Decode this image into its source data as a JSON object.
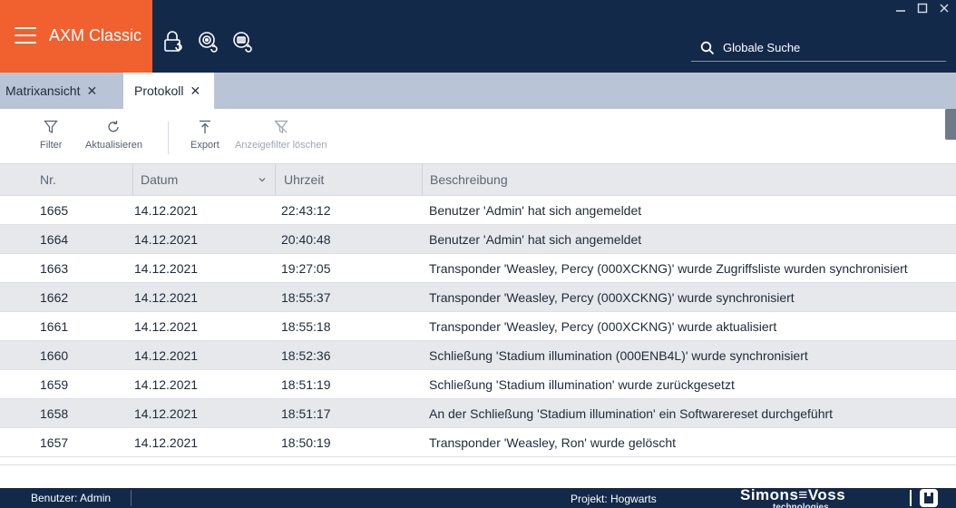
{
  "app": {
    "title": "AXM Classic",
    "window_controls": [
      "minimize",
      "maximize",
      "close"
    ]
  },
  "header": {
    "tools": [
      {
        "icon": "lock-sync-icon"
      },
      {
        "icon": "transponder-sync-icon"
      },
      {
        "icon": "card-sync-icon"
      }
    ],
    "search_placeholder": "Globale Suche"
  },
  "tabs": [
    {
      "label": "Matrixansicht",
      "active": false
    },
    {
      "label": "Protokoll",
      "active": true
    }
  ],
  "toolbar": {
    "filter": "Filter",
    "refresh": "Aktualisieren",
    "export": "Export",
    "clear_filter": "Anzeigefilter löschen"
  },
  "table": {
    "columns": [
      "Nr.",
      "Datum",
      "Uhrzeit",
      "Beschreibung"
    ],
    "rows": [
      {
        "nr": "1665",
        "datum": "14.12.2021",
        "uhrzeit": "22:43:12",
        "beschreibung": "Benutzer 'Admin' hat sich angemeldet"
      },
      {
        "nr": "1664",
        "datum": "14.12.2021",
        "uhrzeit": "20:40:48",
        "beschreibung": "Benutzer 'Admin' hat sich angemeldet"
      },
      {
        "nr": "1663",
        "datum": "14.12.2021",
        "uhrzeit": "19:27:05",
        "beschreibung": "Transponder 'Weasley, Percy (000XCKNG)' wurde Zugriffsliste wurden synchronisiert"
      },
      {
        "nr": "1662",
        "datum": "14.12.2021",
        "uhrzeit": "18:55:37",
        "beschreibung": "Transponder 'Weasley, Percy (000XCKNG)' wurde synchronisiert"
      },
      {
        "nr": "1661",
        "datum": "14.12.2021",
        "uhrzeit": "18:55:18",
        "beschreibung": "Transponder 'Weasley, Percy (000XCKNG)' wurde aktualisiert"
      },
      {
        "nr": "1660",
        "datum": "14.12.2021",
        "uhrzeit": "18:52:36",
        "beschreibung": "Schließung 'Stadium illumination (000ENB4L)' wurde synchronisiert"
      },
      {
        "nr": "1659",
        "datum": "14.12.2021",
        "uhrzeit": "18:51:19",
        "beschreibung": "Schließung 'Stadium illumination' wurde zurückgesetzt"
      },
      {
        "nr": "1658",
        "datum": "14.12.2021",
        "uhrzeit": "18:51:17",
        "beschreibung": "An der Schließung 'Stadium illumination' ein Softwarereset durchgeführt"
      },
      {
        "nr": "1657",
        "datum": "14.12.2021",
        "uhrzeit": "18:50:19",
        "beschreibung": "Transponder 'Weasley, Ron' wurde gelöscht"
      }
    ]
  },
  "status": {
    "user": "Benutzer:  Admin",
    "project": "Projekt: Hogwarts",
    "logo_text": "Simons≡Voss",
    "logo_sub": "technologies"
  },
  "colors": {
    "titlebar": "#13294a",
    "brand": "#f1602f",
    "tabbar": "#b9c5d6",
    "row_alt": "#e6e8ec"
  }
}
